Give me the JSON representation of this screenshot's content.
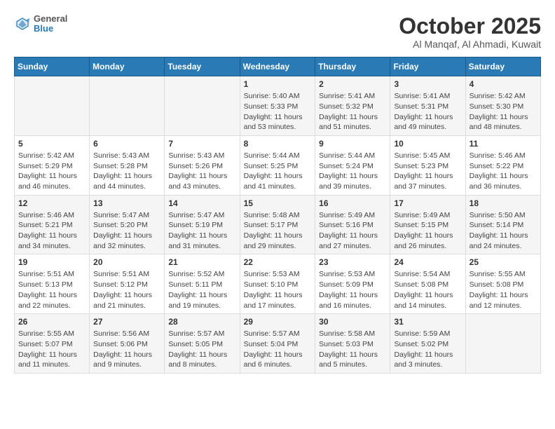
{
  "header": {
    "logo": {
      "line1": "General",
      "line2": "Blue"
    },
    "title": "October 2025",
    "subtitle": "Al Manqaf, Al Ahmadi, Kuwait"
  },
  "weekdays": [
    "Sunday",
    "Monday",
    "Tuesday",
    "Wednesday",
    "Thursday",
    "Friday",
    "Saturday"
  ],
  "weeks": [
    [
      {
        "day": "",
        "info": ""
      },
      {
        "day": "",
        "info": ""
      },
      {
        "day": "",
        "info": ""
      },
      {
        "day": "1",
        "info": "Sunrise: 5:40 AM\nSunset: 5:33 PM\nDaylight: 11 hours and 53 minutes."
      },
      {
        "day": "2",
        "info": "Sunrise: 5:41 AM\nSunset: 5:32 PM\nDaylight: 11 hours and 51 minutes."
      },
      {
        "day": "3",
        "info": "Sunrise: 5:41 AM\nSunset: 5:31 PM\nDaylight: 11 hours and 49 minutes."
      },
      {
        "day": "4",
        "info": "Sunrise: 5:42 AM\nSunset: 5:30 PM\nDaylight: 11 hours and 48 minutes."
      }
    ],
    [
      {
        "day": "5",
        "info": "Sunrise: 5:42 AM\nSunset: 5:29 PM\nDaylight: 11 hours and 46 minutes."
      },
      {
        "day": "6",
        "info": "Sunrise: 5:43 AM\nSunset: 5:28 PM\nDaylight: 11 hours and 44 minutes."
      },
      {
        "day": "7",
        "info": "Sunrise: 5:43 AM\nSunset: 5:26 PM\nDaylight: 11 hours and 43 minutes."
      },
      {
        "day": "8",
        "info": "Sunrise: 5:44 AM\nSunset: 5:25 PM\nDaylight: 11 hours and 41 minutes."
      },
      {
        "day": "9",
        "info": "Sunrise: 5:44 AM\nSunset: 5:24 PM\nDaylight: 11 hours and 39 minutes."
      },
      {
        "day": "10",
        "info": "Sunrise: 5:45 AM\nSunset: 5:23 PM\nDaylight: 11 hours and 37 minutes."
      },
      {
        "day": "11",
        "info": "Sunrise: 5:46 AM\nSunset: 5:22 PM\nDaylight: 11 hours and 36 minutes."
      }
    ],
    [
      {
        "day": "12",
        "info": "Sunrise: 5:46 AM\nSunset: 5:21 PM\nDaylight: 11 hours and 34 minutes."
      },
      {
        "day": "13",
        "info": "Sunrise: 5:47 AM\nSunset: 5:20 PM\nDaylight: 11 hours and 32 minutes."
      },
      {
        "day": "14",
        "info": "Sunrise: 5:47 AM\nSunset: 5:19 PM\nDaylight: 11 hours and 31 minutes."
      },
      {
        "day": "15",
        "info": "Sunrise: 5:48 AM\nSunset: 5:17 PM\nDaylight: 11 hours and 29 minutes."
      },
      {
        "day": "16",
        "info": "Sunrise: 5:49 AM\nSunset: 5:16 PM\nDaylight: 11 hours and 27 minutes."
      },
      {
        "day": "17",
        "info": "Sunrise: 5:49 AM\nSunset: 5:15 PM\nDaylight: 11 hours and 26 minutes."
      },
      {
        "day": "18",
        "info": "Sunrise: 5:50 AM\nSunset: 5:14 PM\nDaylight: 11 hours and 24 minutes."
      }
    ],
    [
      {
        "day": "19",
        "info": "Sunrise: 5:51 AM\nSunset: 5:13 PM\nDaylight: 11 hours and 22 minutes."
      },
      {
        "day": "20",
        "info": "Sunrise: 5:51 AM\nSunset: 5:12 PM\nDaylight: 11 hours and 21 minutes."
      },
      {
        "day": "21",
        "info": "Sunrise: 5:52 AM\nSunset: 5:11 PM\nDaylight: 11 hours and 19 minutes."
      },
      {
        "day": "22",
        "info": "Sunrise: 5:53 AM\nSunset: 5:10 PM\nDaylight: 11 hours and 17 minutes."
      },
      {
        "day": "23",
        "info": "Sunrise: 5:53 AM\nSunset: 5:09 PM\nDaylight: 11 hours and 16 minutes."
      },
      {
        "day": "24",
        "info": "Sunrise: 5:54 AM\nSunset: 5:08 PM\nDaylight: 11 hours and 14 minutes."
      },
      {
        "day": "25",
        "info": "Sunrise: 5:55 AM\nSunset: 5:08 PM\nDaylight: 11 hours and 12 minutes."
      }
    ],
    [
      {
        "day": "26",
        "info": "Sunrise: 5:55 AM\nSunset: 5:07 PM\nDaylight: 11 hours and 11 minutes."
      },
      {
        "day": "27",
        "info": "Sunrise: 5:56 AM\nSunset: 5:06 PM\nDaylight: 11 hours and 9 minutes."
      },
      {
        "day": "28",
        "info": "Sunrise: 5:57 AM\nSunset: 5:05 PM\nDaylight: 11 hours and 8 minutes."
      },
      {
        "day": "29",
        "info": "Sunrise: 5:57 AM\nSunset: 5:04 PM\nDaylight: 11 hours and 6 minutes."
      },
      {
        "day": "30",
        "info": "Sunrise: 5:58 AM\nSunset: 5:03 PM\nDaylight: 11 hours and 5 minutes."
      },
      {
        "day": "31",
        "info": "Sunrise: 5:59 AM\nSunset: 5:02 PM\nDaylight: 11 hours and 3 minutes."
      },
      {
        "day": "",
        "info": ""
      }
    ]
  ]
}
